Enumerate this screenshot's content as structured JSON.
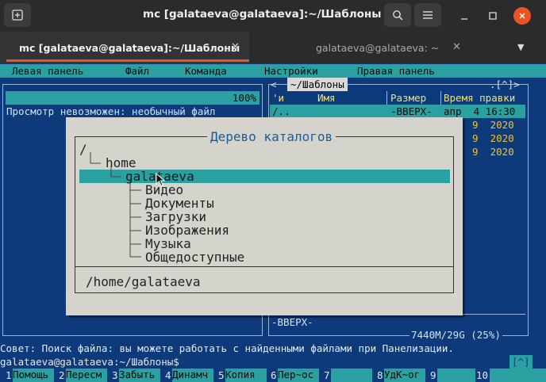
{
  "window": {
    "title": "mc [galataeva@galataeva]:~/Шаблоны",
    "tabs": [
      {
        "label": "mc [galataeva@galataeva]:~/Шаблоны",
        "active": true
      },
      {
        "label": "galataeva@galataeva: ~",
        "active": false
      }
    ],
    "accent": "#e95420"
  },
  "mc": {
    "menu": [
      "Левая панель",
      "Файл",
      "Команда",
      "Настройки",
      "Правая панель"
    ],
    "left_panel": {
      "progress": "100%",
      "message": "Просмотр невозможен: необычный файл"
    },
    "right_panel": {
      "path": "~/Шаблоны",
      "corner": ".[^]>",
      "left_marker": "<",
      "headers": {
        "name_sort": "'и",
        "name": "Имя",
        "size": "Размер",
        "date": "Время правки"
      },
      "rows": [
        {
          "name": "/..",
          "size": "-ВВЕРХ-",
          "date": "апр  4 16:30"
        },
        {
          "name": "",
          "size": "",
          "date": "9  2020"
        },
        {
          "name": "",
          "size": "",
          "date": "9  2020"
        },
        {
          "name": "",
          "size": "",
          "date": "9  2020"
        }
      ],
      "status": "-ВВЕРХ-",
      "free": "7440M/29G (25%)"
    },
    "tree_dialog": {
      "title": "Дерево каталогов",
      "items": [
        {
          "label": "/",
          "depth": 0
        },
        {
          "label": "home",
          "depth": 1
        },
        {
          "label": "galataeva",
          "depth": 2,
          "selected": true
        },
        {
          "label": "Видео",
          "depth": 3
        },
        {
          "label": "Документы",
          "depth": 3
        },
        {
          "label": "Загрузки",
          "depth": 3
        },
        {
          "label": "Изображения",
          "depth": 3
        },
        {
          "label": "Музыка",
          "depth": 3
        },
        {
          "label": "Общедоступные",
          "depth": 3
        }
      ],
      "current_path": "/home/galataeva"
    },
    "hint": "Совет: Поиск файла: вы можете работать с найденными файлами при Панелизации.",
    "prompt": "galataeva@galataeva:~/Шаблоны$",
    "prompt_caret": "[^]",
    "fkeys": [
      {
        "num": "1",
        "label": "Помощь"
      },
      {
        "num": "2",
        "label": "Пересм"
      },
      {
        "num": "3",
        "label": "Забыть"
      },
      {
        "num": "4",
        "label": "Динамч"
      },
      {
        "num": "5",
        "label": "Копия"
      },
      {
        "num": "6",
        "label": "Пер~ос"
      },
      {
        "num": "7",
        "label": ""
      },
      {
        "num": "8",
        "label": "УдК~ог"
      },
      {
        "num": "9",
        "label": ""
      },
      {
        "num": "10",
        "label": ""
      }
    ]
  }
}
